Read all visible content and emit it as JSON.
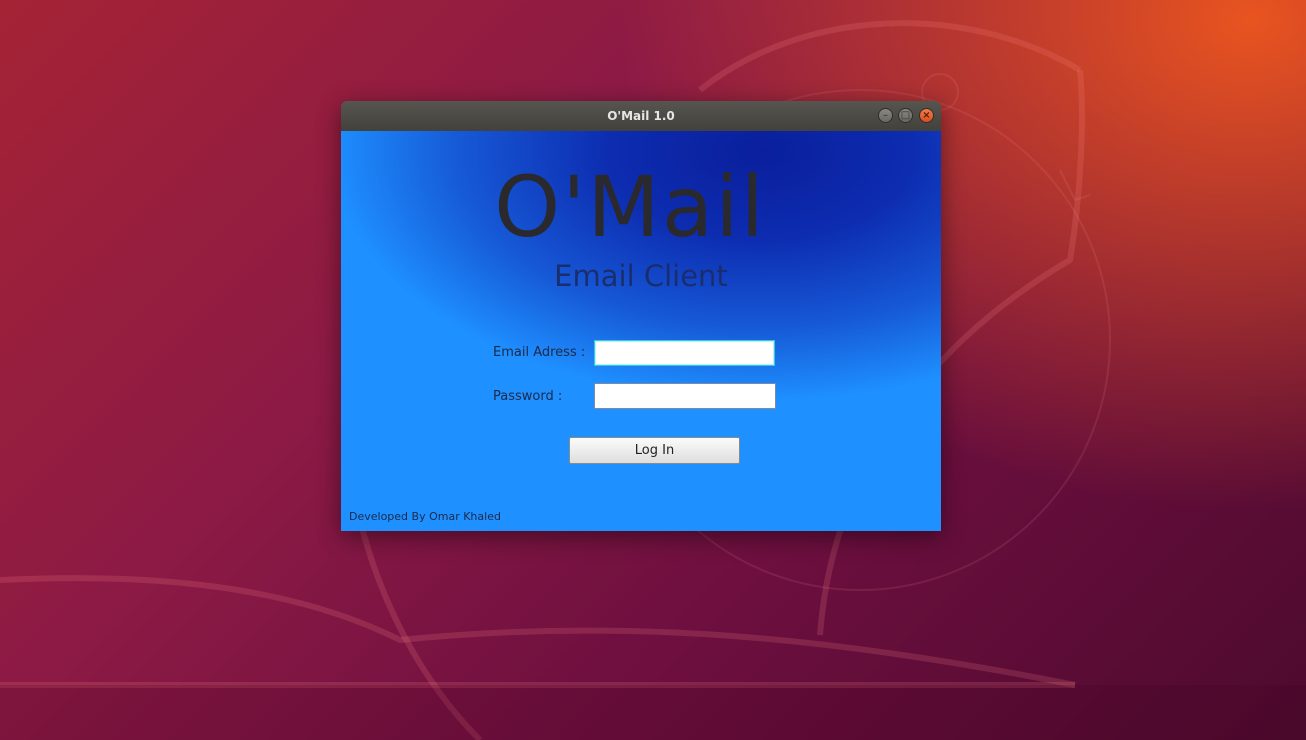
{
  "window": {
    "title": "O'Mail 1.0",
    "controls": {
      "minimize": "–",
      "maximize": "□",
      "close": "×"
    }
  },
  "app": {
    "logo": "O'Mail",
    "subtitle": "Email Client"
  },
  "form": {
    "email_label": "Email Adress :",
    "email_value": "",
    "password_label": "Password :",
    "password_value": "",
    "login_label": "Log In"
  },
  "footer": {
    "credit": "Developed By Omar Khaled"
  },
  "colors": {
    "desktop_orange": "#e95420",
    "desktop_purple": "#6d0f3f",
    "window_bg": "#1e90ff",
    "titlebar": "#4a4844",
    "close_button": "#e95420"
  }
}
